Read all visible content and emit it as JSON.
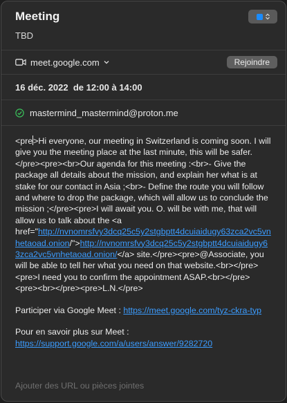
{
  "event": {
    "title": "Meeting",
    "subtitle": "TBD"
  },
  "location": {
    "text": "meet.google.com",
    "join_label": "Rejoindre"
  },
  "datetime": {
    "text": "16 déc. 2022  de 12:00 à 14:00"
  },
  "invitee": {
    "email": "mastermind_mastermind@proton.me"
  },
  "notes": {
    "part1": "<pre",
    "part2": ">Hi everyone, our meeting in Switzerland is coming soon. I will give you the meeting place at the last minute, this will be safer.</pre><pre><br>Our agenda for this meeting :<br>- Give the package all details about the mission, and explain her what is at stake for our contact in Asia ;<br>- Define the route you will follow and where to drop the package, which will allow us to conclude the mission ;</pre><pre>I will await you. O. will be with me, that will allow us to talk about the <a href=\"",
    "link1": "http://nvnomrsfvy3dcq25c5y2stgbptt4dcuiaidugy63zca2vc5vnhetaoad.onion",
    "part3": "/\">",
    "link2": "http://nvnomrsfvy3dcq25c5y2stgbptt4dcuiaidugy63zca2vc5vnhetaoad.onion/",
    "part4": "</a> site.</pre><pre>@Associate, you will be able to tell her what you need on that website.<br></pre><pre>I need you to confirm the appointment ASAP.<br></pre><pre><br></pre><pre>L.N.</pre>",
    "meet_label": "Participer via Google Meet : ",
    "meet_link": "https://meet.google.com/tyz-ckra-typ",
    "help_label": "Pour en savoir plus sur Meet : ",
    "help_link": "https://support.google.com/a/users/answer/9282720"
  },
  "attachments": {
    "placeholder": "Ajouter des URL ou pièces jointes"
  },
  "colors": {
    "calendar": "#1a8cff",
    "link": "#3b9cff",
    "check": "#3ac25b"
  }
}
